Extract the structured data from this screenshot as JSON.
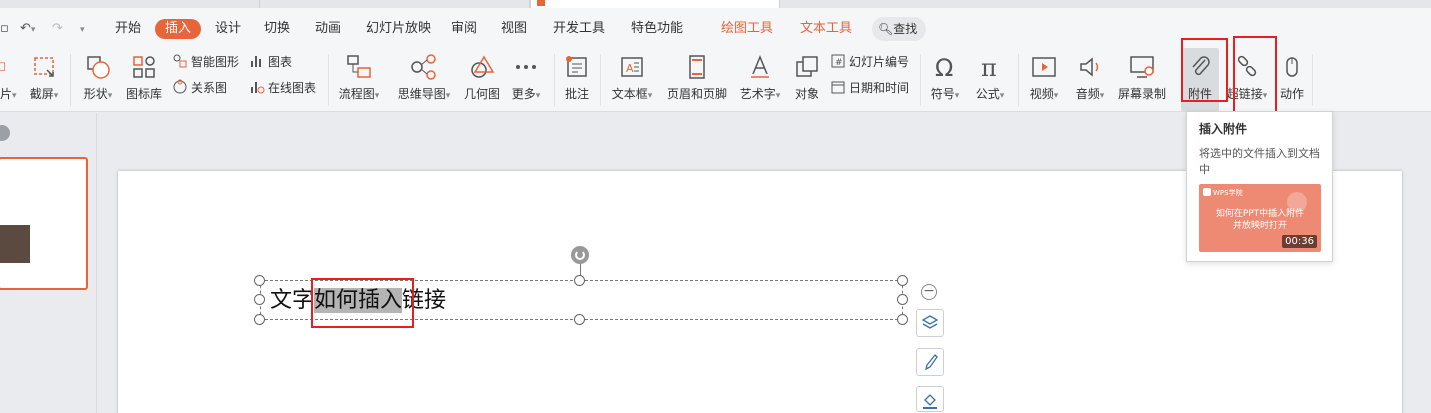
{
  "accent": "#e8643a",
  "highlight_color": "#e52020",
  "menu": {
    "undo_icon": "undo-icon",
    "redo_icon": "redo-icon",
    "tabs": [
      "开始",
      "插入",
      "设计",
      "切换",
      "动画",
      "幻灯片放映",
      "审阅",
      "视图",
      "开发工具",
      "特色功能",
      "绘图工具",
      "文本工具"
    ],
    "active_tab": "插入",
    "search_label": "查找"
  },
  "ribbon": {
    "screenshot_partial": "片",
    "screenshot": "截屏",
    "shape": "形状",
    "icon_lib": "图标库",
    "smart_graphic": "智能图形",
    "relation_graph": "关系图",
    "chart": "图表",
    "online_chart": "在线图表",
    "flowchart": "流程图",
    "mindmap": "思维导图",
    "geometry": "几何图",
    "more": "更多",
    "comment": "批注",
    "textbox": "文本框",
    "header_footer": "页眉和页脚",
    "art_text": "艺术字",
    "object": "对象",
    "slide_number": "幻灯片编号",
    "date_time": "日期和时间",
    "symbol": "符号",
    "formula": "公式",
    "video": "视频",
    "audio": "音频",
    "screen_record": "屏幕录制",
    "attachment": "附件",
    "hyperlink": "超链接",
    "action": "动作"
  },
  "slide": {
    "text_before": "文字",
    "text_selected": "如何插入",
    "text_after": "链接"
  },
  "tooltip": {
    "title": "插入附件",
    "description": "将选中的文件插入到文档中",
    "video_brand": "WPS学院",
    "video_title_line1": "如何在PPT中插入附件",
    "video_title_line2": "并放映时打开",
    "video_duration": "00:36"
  }
}
